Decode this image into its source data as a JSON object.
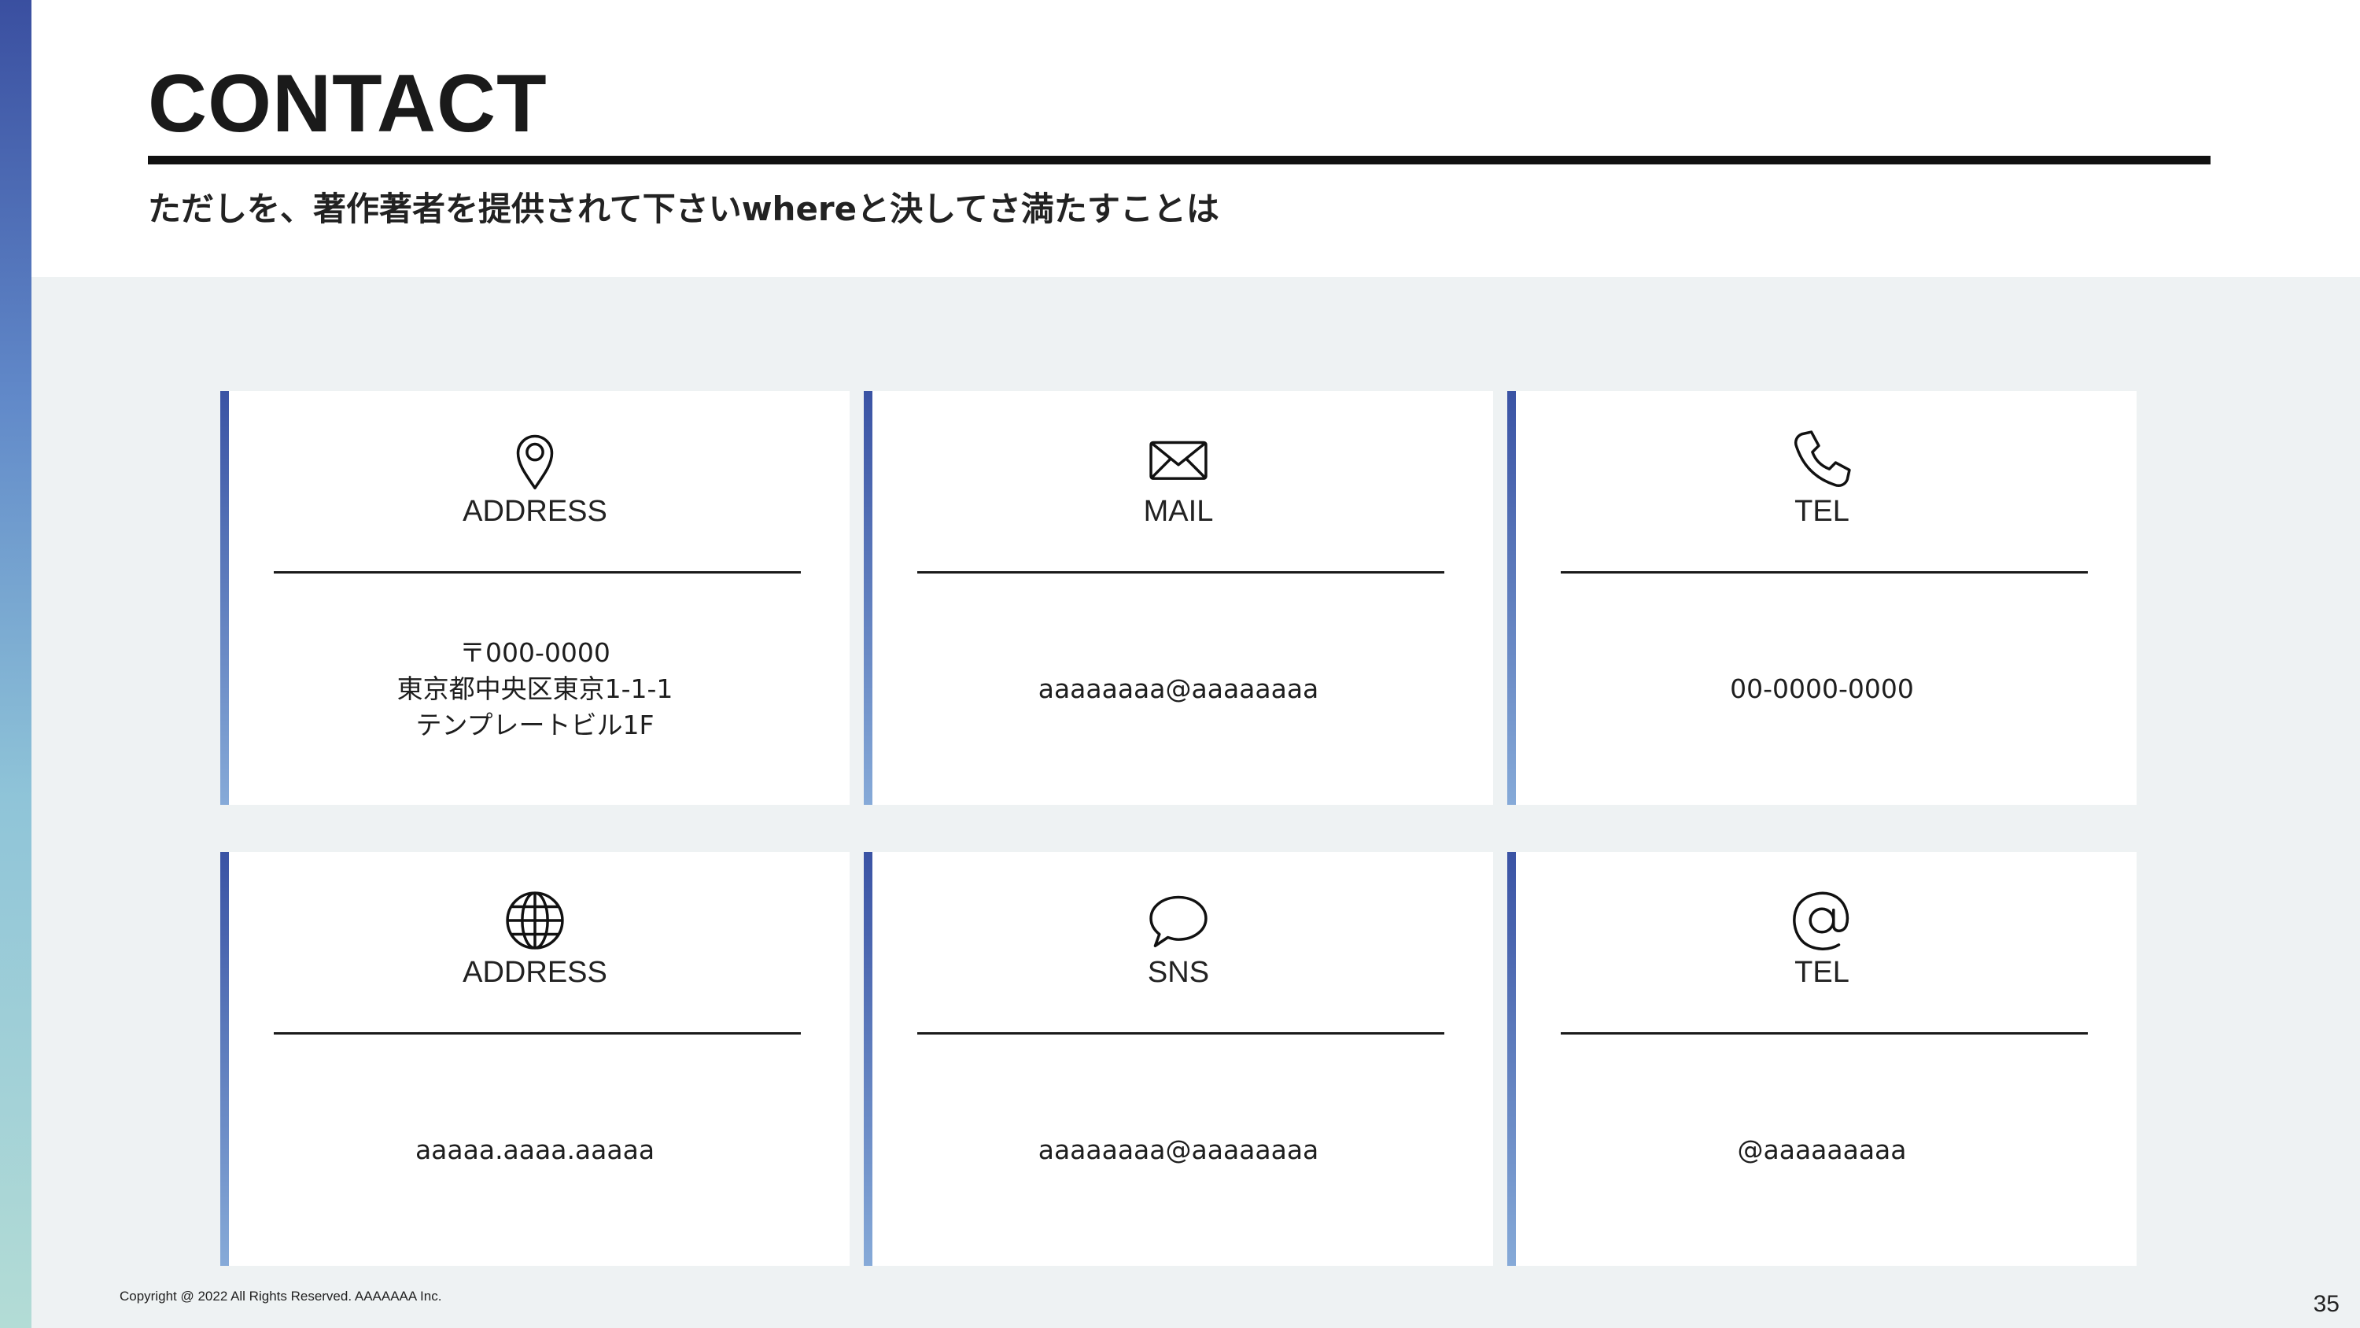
{
  "title": "CONTACT",
  "subtitle": "ただしを、著作著者を提供されて下さいwhereと決してさ満たすことは",
  "cards": [
    {
      "icon": "map-pin-icon",
      "label": "ADDRESS",
      "lines": [
        "〒000-0000",
        "東京都中央区東京1-1-1",
        "テンプレートビル1F"
      ]
    },
    {
      "icon": "mail-icon",
      "label": "MAIL",
      "lines": [
        "aaaaaaaa@aaaaaaaa"
      ]
    },
    {
      "icon": "phone-icon",
      "label": "TEL",
      "lines": [
        "00-0000-0000"
      ]
    },
    {
      "icon": "globe-icon",
      "label": "ADDRESS",
      "lines": [
        "aaaaa.aaaa.aaaaa"
      ]
    },
    {
      "icon": "speech-bubble-icon",
      "label": "SNS",
      "lines": [
        "aaaaaaaa@aaaaaaaa"
      ]
    },
    {
      "icon": "at-sign-icon",
      "label": "TEL",
      "lines": [
        "@aaaaaaaaa"
      ]
    }
  ],
  "footer": {
    "copyright": "Copyright @ 2022 All Rights Reserved. AAAAAAA Inc.",
    "page_number": "35"
  },
  "colors": {
    "accent_top": "#3a53a4",
    "accent_bottom": "#86aad8",
    "background": "#eef2f3",
    "card": "#ffffff",
    "text": "#1a1a1a"
  }
}
